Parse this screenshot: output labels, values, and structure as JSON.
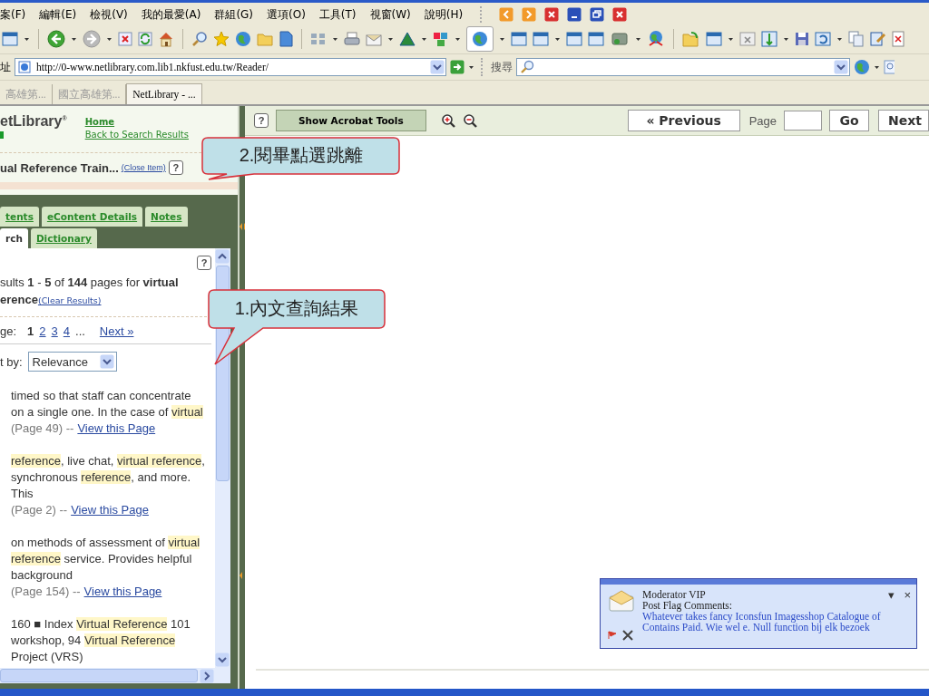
{
  "menu_bar": {
    "items": [
      "案(F)",
      "編輯(E)",
      "檢視(V)",
      "我的最愛(A)",
      "群組(G)",
      "選項(O)",
      "工具(T)",
      "視窗(W)",
      "說明(H)"
    ]
  },
  "address_bar": {
    "label": "址",
    "url": "http://0-www.netlibrary.com.lib1.nkfust.edu.tw/Reader/",
    "search_label": "搜尋"
  },
  "tabs": [
    {
      "label": "高雄第...",
      "selected": false
    },
    {
      "label": "國立高雄第...",
      "selected": false
    },
    {
      "label": "NetLibrary - ...",
      "selected": true
    }
  ],
  "sidebar": {
    "logo": "etLibrary$^{®}$",
    "links": [
      "Home",
      "Back to Search Results"
    ],
    "item_title": "ual Reference Train...",
    "close_link": "(Close Item)",
    "help": "?",
    "tab_rows": [
      [
        {
          "label": "tents",
          "selected": false
        },
        {
          "label": "eContent Details",
          "selected": false
        },
        {
          "label": "Notes",
          "selected": false
        }
      ],
      [
        {
          "label": "rch",
          "selected": true
        },
        {
          "label": "Dictionary",
          "selected": false
        }
      ]
    ],
    "results_help": "?",
    "summary_lines": [
      "sults **1** - **5** of **144** pages for **virtual**",
      "**erence**"
    ],
    "clear_link": "(Clear Results)",
    "pager": {
      "label": "ge:",
      "pages": [
        {
          "label": "1",
          "selected": true
        },
        {
          "label": "2",
          "selected": false
        },
        {
          "label": "3",
          "selected": false
        },
        {
          "label": "4",
          "selected": false
        }
      ],
      "ellipsis": "...",
      "next": "Next »"
    },
    "sort": {
      "label": "t by:",
      "value": "Relevance"
    },
    "results": [
      {
        "snippet": [
          {
            "text": "timed so that staff can concentrate on a single one. In the case of ",
            "highlight": false
          },
          {
            "text": "virtual",
            "highlight": true
          }
        ],
        "page": "(Page 49) --",
        "link": "View this Page"
      },
      {
        "snippet": [
          {
            "text": "reference",
            "highlight": true
          },
          {
            "text": ", live chat, ",
            "highlight": false
          },
          {
            "text": "virtual reference",
            "highlight": true
          },
          {
            "text": ", synchronous ",
            "highlight": false
          },
          {
            "text": "reference",
            "highlight": true
          },
          {
            "text": ", and more. This",
            "highlight": false
          }
        ],
        "page": "(Page 2) --",
        "link": "View this Page"
      },
      {
        "snippet": [
          {
            "text": "on methods of assessment of ",
            "highlight": false
          },
          {
            "text": "virtual reference",
            "highlight": true
          },
          {
            "text": " service. Provides helpful background",
            "highlight": false
          }
        ],
        "page": "(Page 154) --",
        "link": "View this Page"
      },
      {
        "snippet": [
          {
            "text": "160 ■ Index ",
            "highlight": false
          },
          {
            "text": "Virtual Reference",
            "highlight": true
          },
          {
            "text": " 101 workshop, 94 ",
            "highlight": false
          },
          {
            "text": "Virtual Reference",
            "highlight": true
          },
          {
            "text": " Project (VRS)",
            "highlight": false
          }
        ]
      }
    ]
  },
  "viewer": {
    "help": "?",
    "acrobat_button": "Show Acrobat Tools",
    "previous": "« Previous",
    "page_label": "Page",
    "go": "Go",
    "next": "Next"
  },
  "notification": {
    "title": "Moderator VIP",
    "subtitle": "Post Flag Comments:",
    "message": "Whatever takes fancy Iconsfun Imagesshop Catalogue of Contains Paid. Wie wel e. Null function bij elk bezoek",
    "menu": "▾",
    "close": "×"
  },
  "callouts": [
    {
      "text": "2.閱畢點選跳離"
    },
    {
      "text": "1.內文查詢結果"
    }
  ]
}
